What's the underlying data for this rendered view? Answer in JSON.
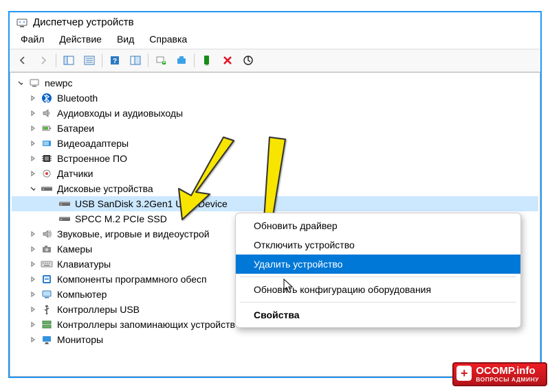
{
  "title": "Диспетчер устройств",
  "menus": {
    "file": "Файл",
    "action": "Действие",
    "view": "Вид",
    "help": "Справка"
  },
  "root": {
    "name": "newpc"
  },
  "categories": [
    {
      "icon": "bluetooth",
      "label": "Bluetooth",
      "expanded": false
    },
    {
      "icon": "audio",
      "label": "Аудиовходы и аудиовыходы",
      "expanded": false
    },
    {
      "icon": "battery",
      "label": "Батареи",
      "expanded": false
    },
    {
      "icon": "video",
      "label": "Видеоадаптеры",
      "expanded": false
    },
    {
      "icon": "firmware",
      "label": "Встроенное ПО",
      "expanded": false
    },
    {
      "icon": "sensor",
      "label": "Датчики",
      "expanded": false
    },
    {
      "icon": "disk",
      "label": "Дисковые устройства",
      "expanded": true,
      "children": [
        {
          "icon": "disk",
          "label": "USB  SanDisk 3.2Gen1 USB Device",
          "selected": true
        },
        {
          "icon": "disk",
          "label": "SPCC M.2 PCIe SSD"
        }
      ]
    },
    {
      "icon": "sound",
      "label": "Звуковые, игровые и видеоустрой",
      "expanded": false
    },
    {
      "icon": "camera",
      "label": "Камеры",
      "expanded": false
    },
    {
      "icon": "keyboard",
      "label": "Клавиатуры",
      "expanded": false
    },
    {
      "icon": "software",
      "label": "Компоненты программного обесп",
      "expanded": false
    },
    {
      "icon": "computer",
      "label": "Компьютер",
      "expanded": false
    },
    {
      "icon": "usb",
      "label": "Контроллеры USB",
      "expanded": false
    },
    {
      "icon": "storagectrl",
      "label": "Контроллеры запоминающих устройств",
      "expanded": false
    },
    {
      "icon": "monitor",
      "label": "Мониторы",
      "expanded": false
    }
  ],
  "context_menu": {
    "update": "Обновить драйвер",
    "disable": "Отключить устройство",
    "uninstall": "Удалить устройство",
    "scan": "Обновить конфигурацию оборудования",
    "props": "Свойства"
  },
  "watermark": {
    "main": "OCOMP.info",
    "sub": "ВОПРОСЫ АДМИНУ"
  }
}
